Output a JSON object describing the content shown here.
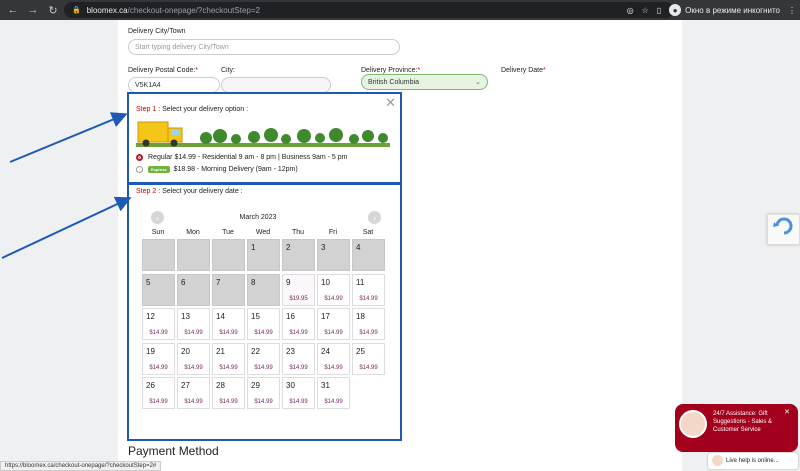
{
  "browser": {
    "url_host": "bloomex.ca",
    "url_path": "/checkout-onepage/?checkoutStep=2",
    "incognito_label": "Окно в режиме инкогнито"
  },
  "form": {
    "city_label": "Delivery City/Town",
    "city_placeholder": "Start typing delivery City/Town",
    "postal_label": "Delivery Postal Code:",
    "postal_value": "V5K1A4",
    "city2_label": "City:",
    "province_label": "Delivery Province:",
    "province_value": "British Columbia",
    "date_label": "Delivery Date",
    "req": "*"
  },
  "step1": {
    "step": "Step 1",
    "text": " : Select your delivery option :",
    "options": [
      {
        "label": "Regular $14.99 - Residential 9 am - 8 pm | Business 9am - 5 pm",
        "selected": true
      },
      {
        "label": "$18.98 - Morning Delivery (9am - 12pm)",
        "selected": false,
        "badge": "Express"
      }
    ]
  },
  "step2": {
    "step": "Step 2",
    "text": " : Select your delivery date :",
    "month": "March 2023",
    "days": [
      "Sun",
      "Mon",
      "Tue",
      "Wed",
      "Thu",
      "Fri",
      "Sat"
    ],
    "weeks": [
      [
        {
          "d": ""
        },
        {
          "d": ""
        },
        {
          "d": ""
        },
        {
          "d": "1"
        },
        {
          "d": "2"
        },
        {
          "d": "3"
        },
        {
          "d": "4"
        }
      ],
      [
        {
          "d": "5"
        },
        {
          "d": "6"
        },
        {
          "d": "7"
        },
        {
          "d": "8"
        },
        {
          "d": "9",
          "p": "$19.95"
        },
        {
          "d": "10",
          "p": "$14.99"
        },
        {
          "d": "11",
          "p": "$14.99"
        }
      ],
      [
        {
          "d": "12",
          "p": "$14.99"
        },
        {
          "d": "13",
          "p": "$14.99"
        },
        {
          "d": "14",
          "p": "$14.99"
        },
        {
          "d": "15",
          "p": "$14.99"
        },
        {
          "d": "16",
          "p": "$14.99"
        },
        {
          "d": "17",
          "p": "$14.99"
        },
        {
          "d": "18",
          "p": "$14.99"
        }
      ],
      [
        {
          "d": "19",
          "p": "$14.99"
        },
        {
          "d": "20",
          "p": "$14.99"
        },
        {
          "d": "21",
          "p": "$14.99"
        },
        {
          "d": "22",
          "p": "$14.99"
        },
        {
          "d": "23",
          "p": "$14.99"
        },
        {
          "d": "24",
          "p": "$14.99"
        },
        {
          "d": "25",
          "p": "$14.99"
        }
      ],
      [
        {
          "d": "26",
          "p": "$14.99"
        },
        {
          "d": "27",
          "p": "$14.99"
        },
        {
          "d": "28",
          "p": "$14.99"
        },
        {
          "d": "29",
          "p": "$14.99"
        },
        {
          "d": "30",
          "p": "$14.99"
        },
        {
          "d": "31",
          "p": "$14.99"
        },
        {
          "d": null
        }
      ]
    ]
  },
  "payment_title": "Payment Method",
  "chat": {
    "text": "24/7 Assistance: Gift Suggestions - Sales & Customer Service",
    "live": "Live help is online..."
  },
  "status_url": "https://bloomex.ca/checkout-onepage/?checkoutStep=2#"
}
